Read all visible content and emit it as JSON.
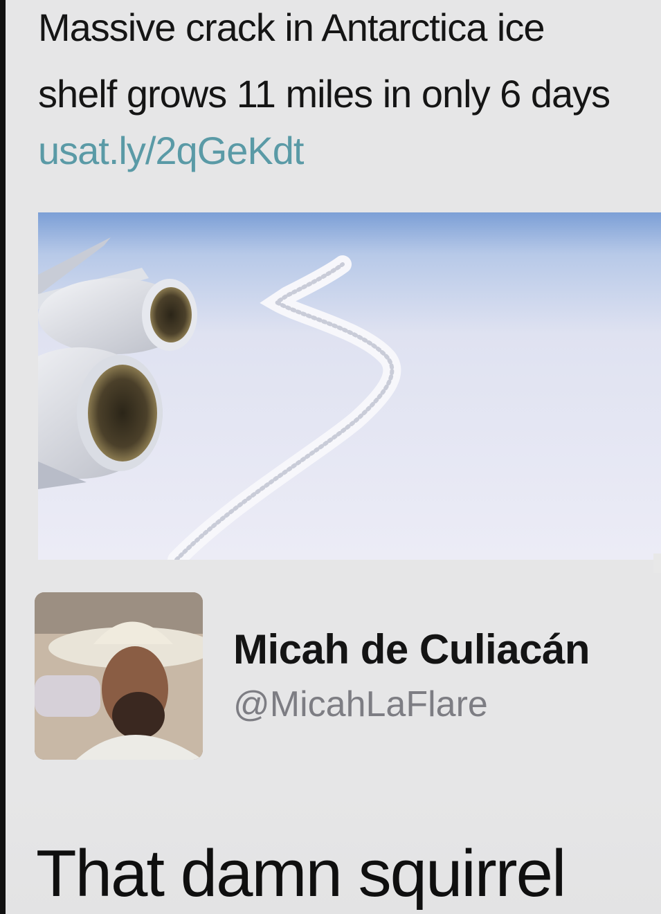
{
  "tweet": {
    "text_lines": [
      "Massive crack in Antarctica ice",
      "shelf grows 11 miles in only 6 days"
    ],
    "link": "usat.ly/2qGeKdt",
    "link_color": "#5a9aa6",
    "media_description_icon": "photo-icon"
  },
  "profile": {
    "display_name": "Micah de Culiacán",
    "handle": "@MicahLaFlare"
  },
  "caption": {
    "text": "That damn squirrel"
  },
  "colors": {
    "background": "#e6e6e7",
    "text": "#151515",
    "handle": "#7d7d83"
  }
}
